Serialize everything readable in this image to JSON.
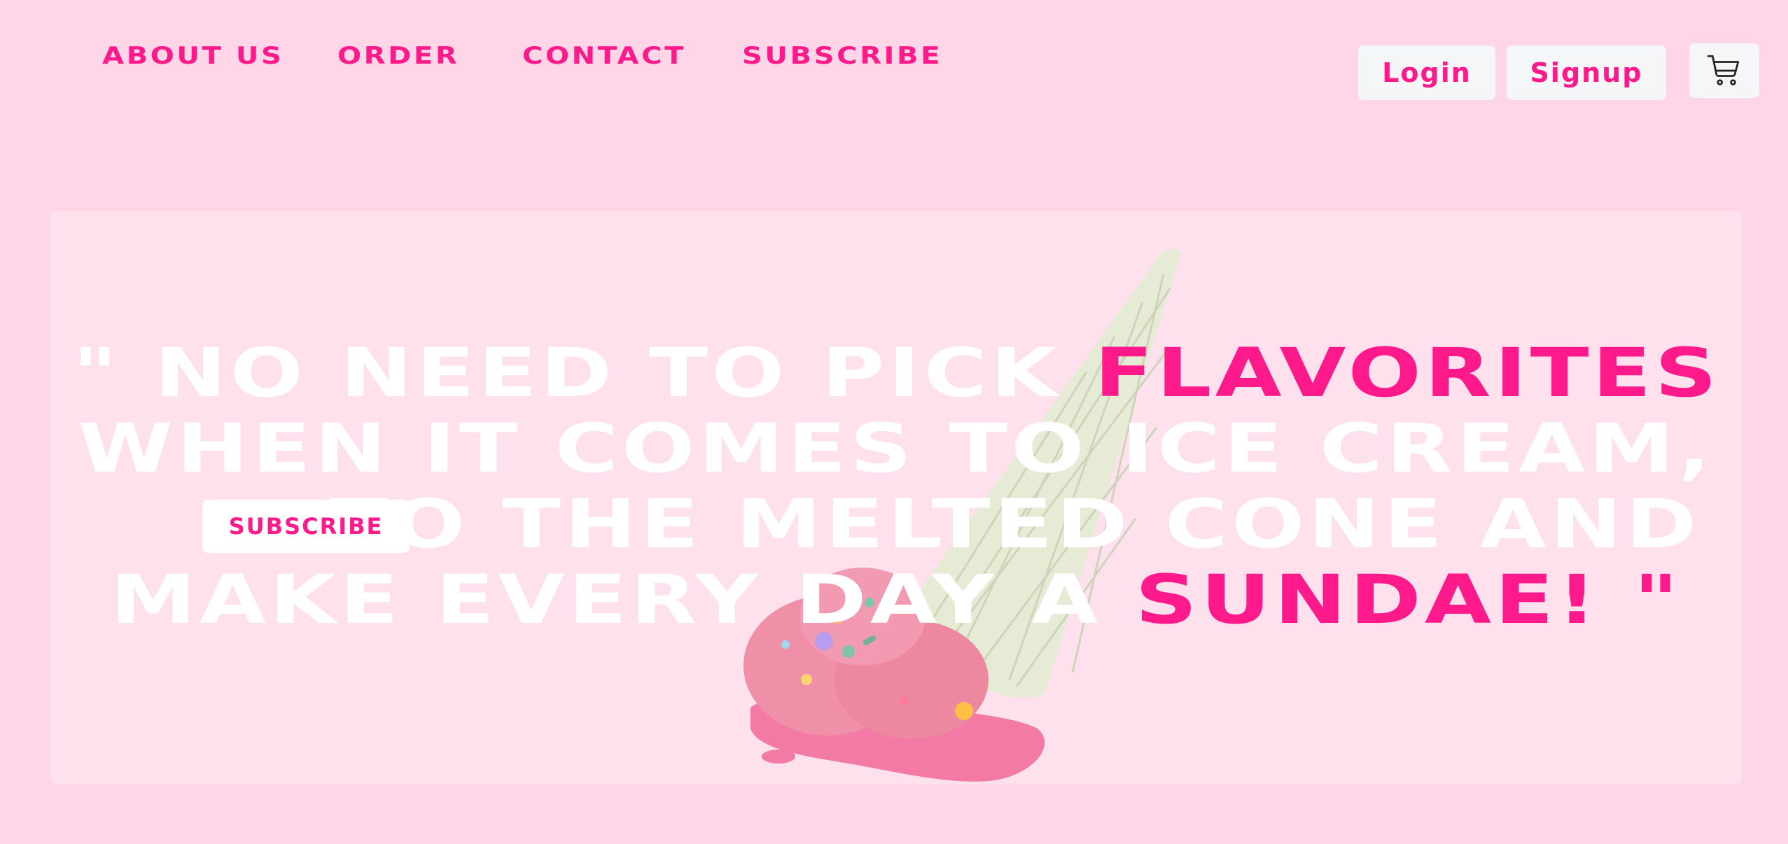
{
  "nav": {
    "items": [
      "ABOUT US",
      "ORDER",
      "CONTACT",
      "SUBSCRIBE"
    ]
  },
  "auth": {
    "login": "Login",
    "signup": "Signup",
    "cart_icon": "cart-icon"
  },
  "hero": {
    "quote": {
      "line1_a": "\" NO NEED TO PICK ",
      "line1_b": "FLAVORITES",
      "line2": "WHEN IT COMES TO ICE CREAM,",
      "line3": "TO THE MELTED CONE AND",
      "line4_a": "MAKE EVERY DAY A ",
      "line4_b": "SUNDAE! \""
    },
    "subscribe_button": "SUBSCRIBE"
  },
  "colors": {
    "background": "#ffd6e7",
    "panel": "#ffe0ed",
    "accent": "#ff1a8c",
    "button_bg": "#f4f6f8"
  }
}
